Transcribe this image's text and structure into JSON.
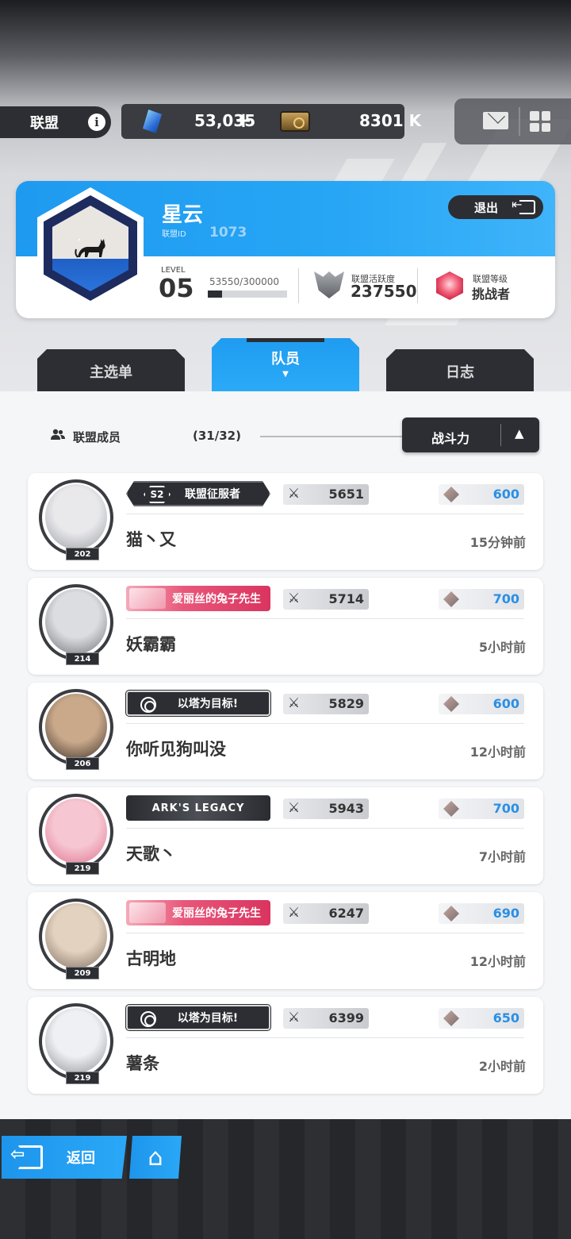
{
  "topbar": {
    "title": "联盟",
    "info_icon": "info-icon",
    "gems": "53,035",
    "gems_plus": "+",
    "credits": "8301 K",
    "mail_icon": "mail-icon",
    "menu_icon": "grid-menu-icon"
  },
  "union": {
    "name": "星云",
    "id_label": "联盟ID",
    "id_value": "1073",
    "exit_label": "退出",
    "level_label": "LEVEL",
    "level_value": "05",
    "exp_text": "53550/300000",
    "exp_current": 53550,
    "exp_max": 300000,
    "activity_label": "联盟活跃度",
    "activity_value": "237550",
    "rank_label": "联盟等级",
    "rank_value": "挑战者",
    "emblem": "cat-emblem",
    "accent_color": "#1e9af0"
  },
  "tabs": [
    {
      "label": "主选单",
      "active": false
    },
    {
      "label": "队员",
      "active": true
    },
    {
      "label": "日志",
      "active": false
    }
  ],
  "members_header": {
    "label": "联盟成员",
    "count": "(31/32)",
    "sort_label": "战斗力"
  },
  "members": [
    {
      "level": "202",
      "badge_type": "conq",
      "badge_text": "联盟征服者",
      "badge_prefix": "S2",
      "power": "5651",
      "contrib": "600",
      "name": "猫丶又",
      "time": "15分钟前"
    },
    {
      "level": "214",
      "badge_type": "pink",
      "badge_text": "爱丽丝的兔子先生",
      "power": "5714",
      "contrib": "700",
      "name": "妖霸霸",
      "time": "5小时前"
    },
    {
      "level": "206",
      "badge_type": "target",
      "badge_text": "以塔为目标!",
      "power": "5829",
      "contrib": "600",
      "name": "你听见狗叫没",
      "time": "12小时前"
    },
    {
      "level": "219",
      "badge_type": "ark",
      "badge_text": "ARK'S LEGACY",
      "power": "5943",
      "contrib": "700",
      "name": "天歌丶",
      "time": "7小时前"
    },
    {
      "level": "209",
      "badge_type": "pink",
      "badge_text": "爱丽丝的兔子先生",
      "power": "6247",
      "contrib": "690",
      "name": "古明地",
      "time": "12小时前"
    },
    {
      "level": "219",
      "badge_type": "target",
      "badge_text": "以塔为目标!",
      "power": "6399",
      "contrib": "650",
      "name": "薯条",
      "time": "2小时前"
    }
  ],
  "bottom": {
    "back_label": "返回",
    "home_icon": "home-icon"
  }
}
